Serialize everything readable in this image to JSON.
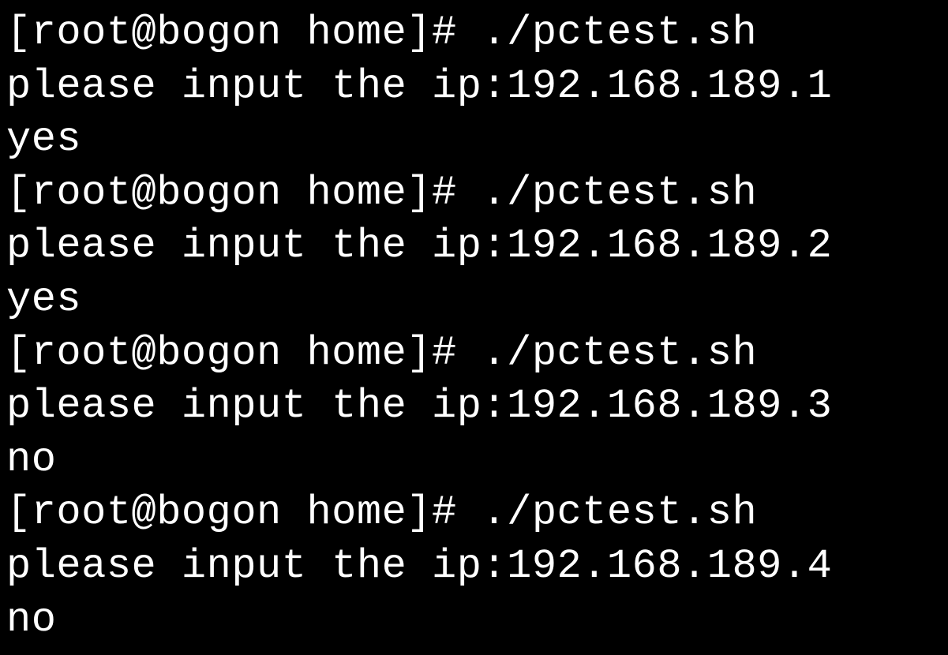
{
  "terminal": {
    "sessions": [
      {
        "prompt": "[root@bogon home]# ",
        "command": "./pctest.sh",
        "input_label": "please input the ip:",
        "input_value": "192.168.189.1",
        "result": "yes"
      },
      {
        "prompt": "[root@bogon home]# ",
        "command": "./pctest.sh",
        "input_label": "please input the ip:",
        "input_value": "192.168.189.2",
        "result": "yes"
      },
      {
        "prompt": "[root@bogon home]# ",
        "command": "./pctest.sh",
        "input_label": "please input the ip:",
        "input_value": "192.168.189.3",
        "result": "no"
      },
      {
        "prompt": "[root@bogon home]# ",
        "command": "./pctest.sh",
        "input_label": "please input the ip:",
        "input_value": "192.168.189.4",
        "result": "no"
      }
    ]
  }
}
